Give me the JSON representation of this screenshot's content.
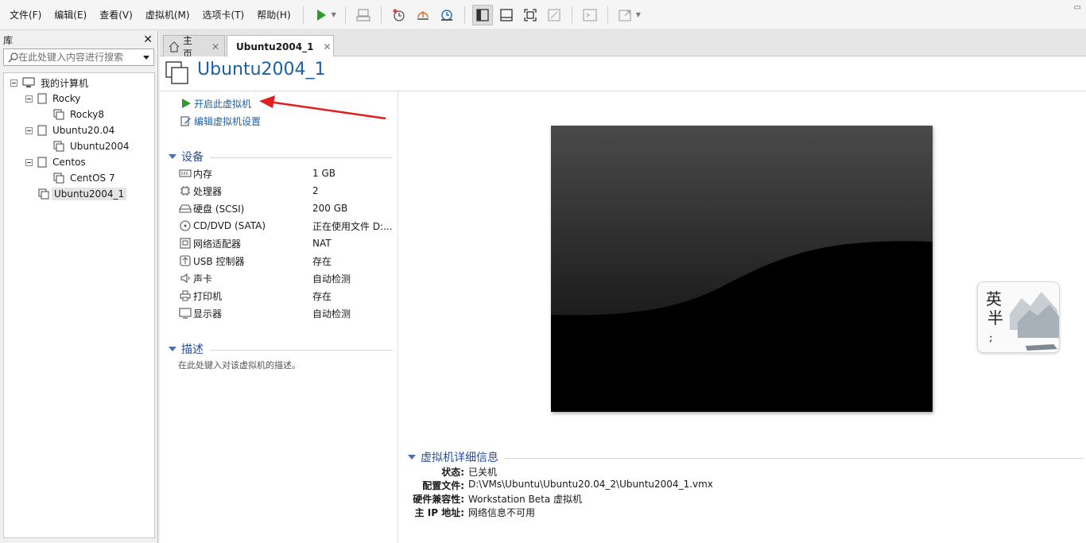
{
  "menubar": {
    "items": [
      "文件(F)",
      "编辑(E)",
      "查看(V)",
      "虚拟机(M)",
      "选项卡(T)",
      "帮助(H)"
    ],
    "icons": [
      "play-icon",
      "send-keys-icon",
      "snapshot-icon",
      "revert-snapshot-icon",
      "snapshot-manager-icon",
      "library-view-icon",
      "thumbnail-bar-icon",
      "fullscreen-icon",
      "unity-icon",
      "console-icon",
      "stretch-icon"
    ]
  },
  "library": {
    "title": "库",
    "search_placeholder": "在此处键入内容进行搜索",
    "tree": {
      "root": "我的计算机",
      "items": [
        {
          "label": "Rocky"
        },
        {
          "label": "Rocky8"
        },
        {
          "label": "Ubuntu20.04"
        },
        {
          "label": "Ubuntu2004"
        },
        {
          "label": "Centos"
        },
        {
          "label": "CentOS 7"
        },
        {
          "label": "Ubuntu2004_1"
        }
      ]
    }
  },
  "tabs": [
    {
      "label": "主页"
    },
    {
      "label": "Ubuntu2004_1"
    }
  ],
  "vm": {
    "title": "Ubuntu2004_1",
    "actions": {
      "power_on": "开启此虚拟机",
      "edit_settings": "编辑虚拟机设置"
    },
    "devices_header": "设备",
    "devices": [
      {
        "name": "内存",
        "value": "1 GB",
        "icon": "memory-icon"
      },
      {
        "name": "处理器",
        "value": "2",
        "icon": "cpu-icon"
      },
      {
        "name": "硬盘 (SCSI)",
        "value": "200 GB",
        "icon": "hard-disk-icon"
      },
      {
        "name": "CD/DVD (SATA)",
        "value": "正在使用文件 D:...",
        "icon": "cd-dvd-icon"
      },
      {
        "name": "网络适配器",
        "value": "NAT",
        "icon": "network-adapter-icon"
      },
      {
        "name": "USB 控制器",
        "value": "存在",
        "icon": "usb-icon"
      },
      {
        "name": "声卡",
        "value": "自动检测",
        "icon": "sound-card-icon"
      },
      {
        "name": "打印机",
        "value": "存在",
        "icon": "printer-icon"
      },
      {
        "name": "显示器",
        "value": "自动检测",
        "icon": "display-icon"
      }
    ],
    "description_header": "描述",
    "description_placeholder": "在此处键入对该虚拟机的描述。",
    "details_header": "虚拟机详细信息",
    "details": [
      {
        "key": "状态:",
        "value": "已关机"
      },
      {
        "key": "配置文件:",
        "value": "D:\\VMs\\Ubuntu\\Ubuntu20.04_2\\Ubuntu2004_1.vmx"
      },
      {
        "key": "硬件兼容性:",
        "value": "Workstation Beta 虚拟机"
      },
      {
        "key": "主 IP 地址:",
        "value": "网络信息不可用"
      }
    ]
  },
  "colors": {
    "accent": "#1d5fa8",
    "section_header": "#2a4e9c",
    "play_green": "#2e9b2e",
    "annotation_arrow": "#e02020"
  }
}
